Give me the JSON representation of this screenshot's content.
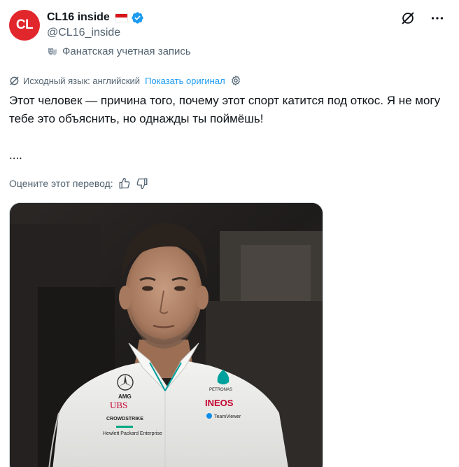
{
  "author": {
    "display_name": "CL16 inside",
    "handle": "@CL16_inside",
    "avatar_text": "CL",
    "avatar_color": "#e1262c",
    "flag": "monaco-flag-icon",
    "verified_icon": "verified-badge-icon",
    "label": "Фанатская учетная запись"
  },
  "translation": {
    "source_language": "Исходный язык: английский",
    "show_original": "Показать оригинал"
  },
  "tweet": {
    "text": "Этот человек — причина того, почему этот спорт катится под откос. Я не могу тебе это объяснить, но однажды ты поймёшь!",
    "dots": "...."
  },
  "rating": {
    "label": "Оцените этот перевод:"
  },
  "media": {
    "shirt_labels": {
      "ubs": "UBS",
      "ineos": "INEOS",
      "petronas": "PETRONAS",
      "crowdstrike": "CROWDSTRIKE",
      "hpe": "Hewlett Packard Enterprise",
      "teamviewer": "TeamViewer",
      "amg": "AMG"
    }
  },
  "colors": {
    "link": "#1d9bf0",
    "secondary_text": "#536471",
    "primary_text": "#0f1419"
  }
}
